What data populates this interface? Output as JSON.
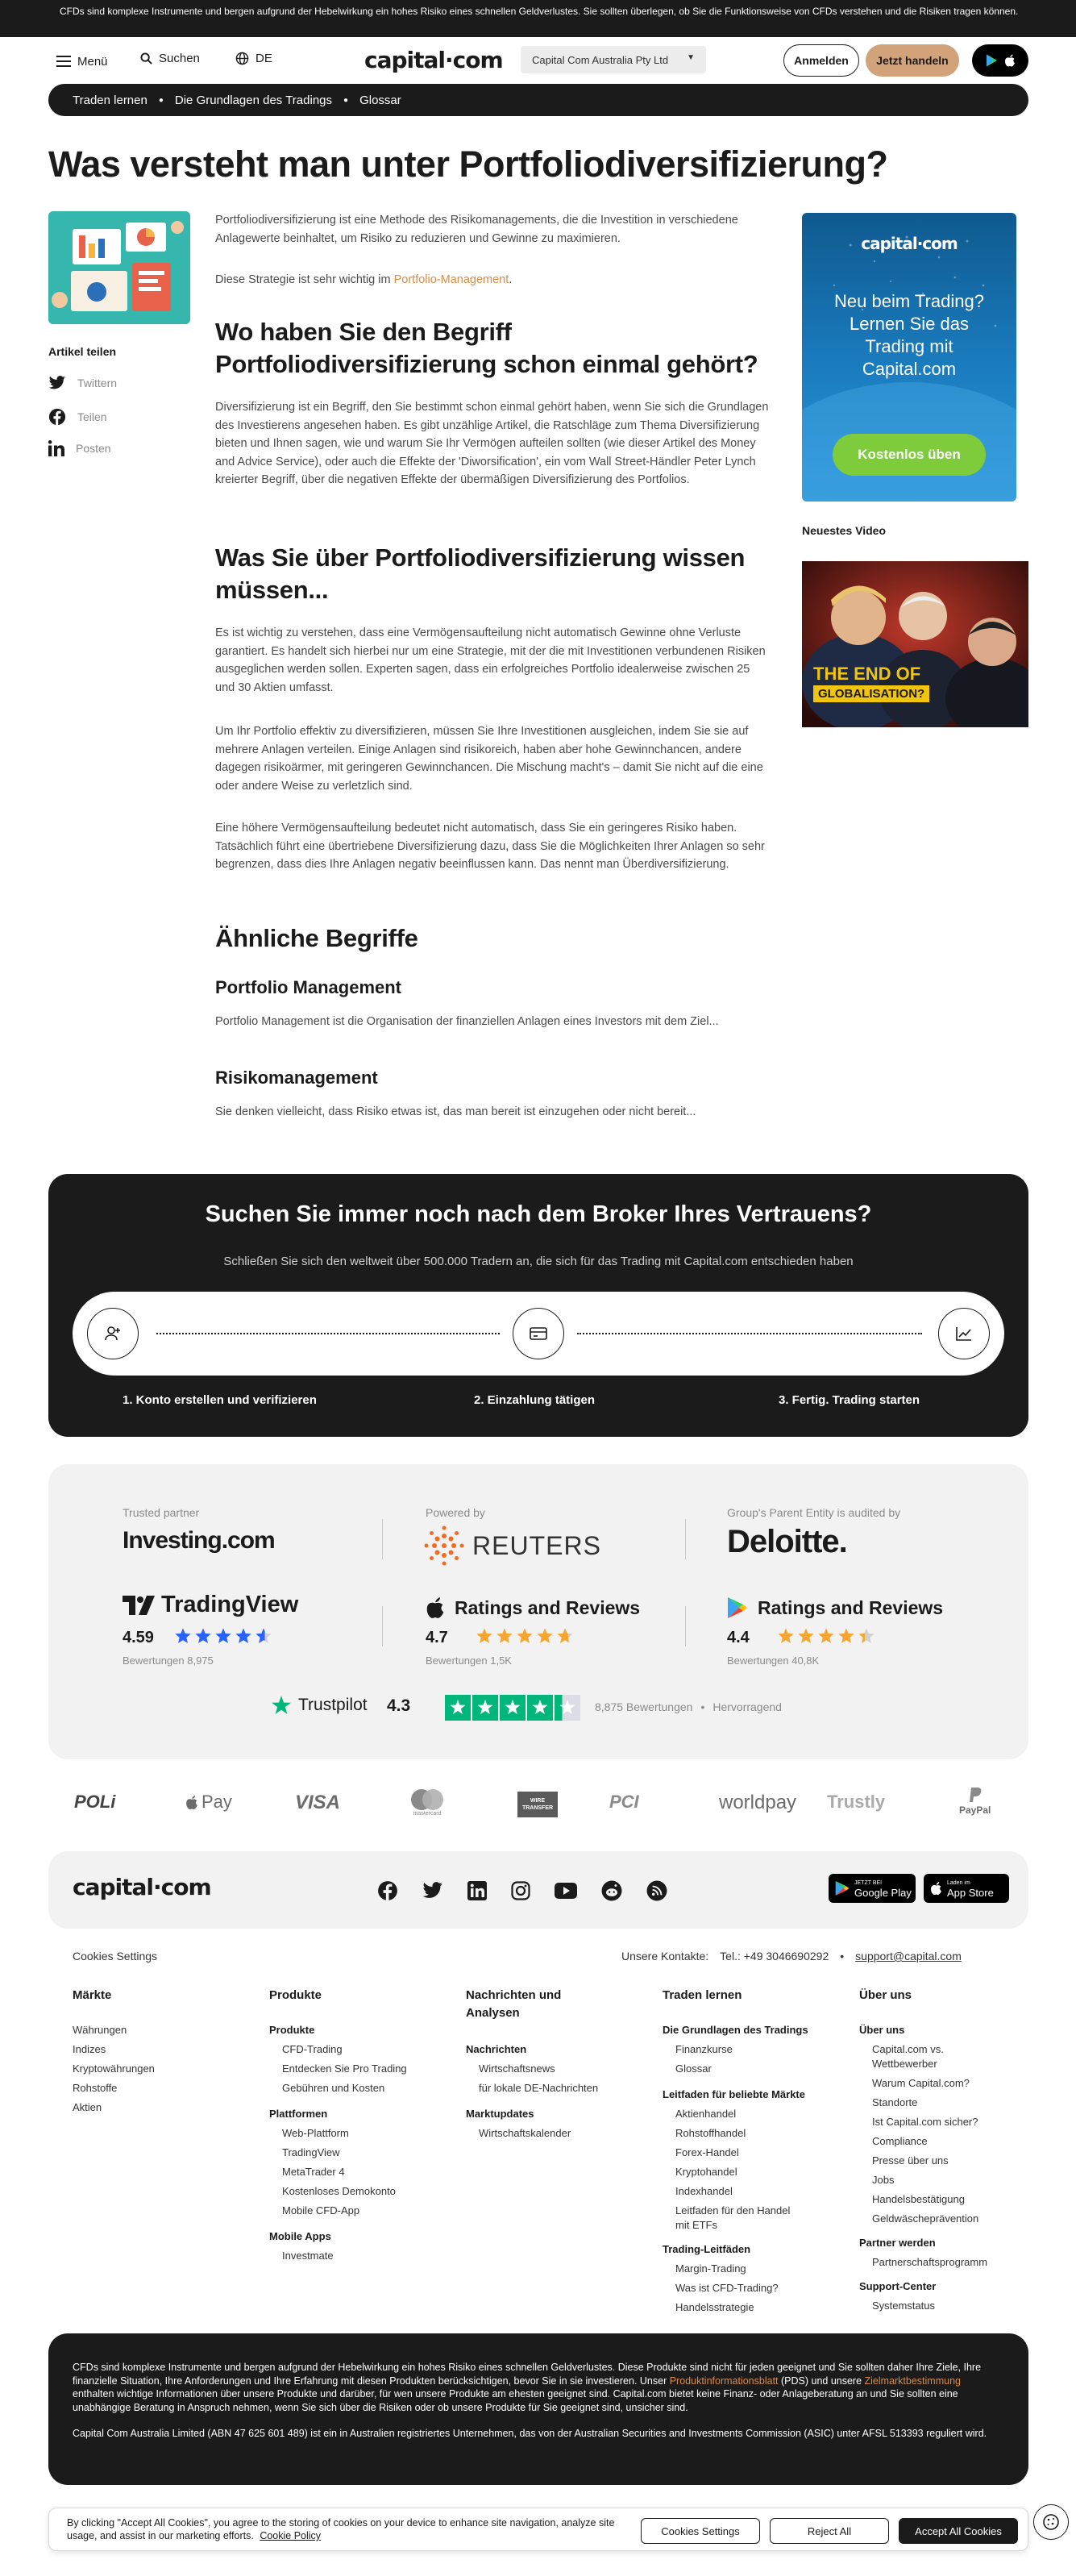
{
  "risk_banner": "CFDs sind komplexe Instrumente und bergen aufgrund der Hebelwirkung ein hohes Risiko eines schnellen Geldverlustes. Sie sollten überlegen, ob Sie die Funktionsweise von CFDs verstehen und die Risiken tragen können.",
  "header": {
    "menu_label": "Menü",
    "search_label": "Suchen",
    "language": "DE",
    "logo": "capital·com",
    "entity_select": "Capital Com Australia Pty Ltd",
    "login": "Anmelden",
    "trade": "Jetzt handeln"
  },
  "breadcrumb": [
    "Traden lernen",
    "Die Grundlagen des Tradings",
    "Glossar"
  ],
  "title": "Was versteht man unter Portfoliodiversifizierung?",
  "share": {
    "title": "Artikel teilen",
    "items": [
      "Twittern",
      "Teilen",
      "Posten"
    ]
  },
  "article": {
    "intro": "Portfoliodiversifizierung ist eine Methode des Risikomanagements, die die Investition in verschiedene Anlagewerte beinhaltet, um Risiko zu reduzieren und Gewinne zu maximieren.",
    "strategy_prefix": "Diese Strategie ist sehr wichtig im ",
    "strategy_link": "Portfolio-Management",
    "strategy_suffix": ".",
    "h2_1": "Wo haben Sie den Begriff Portfoliodiversifizierung schon einmal gehört?",
    "p1": "Diversifizierung ist ein Begriff, den Sie bestimmt schon einmal gehört haben, wenn Sie sich die Grundlagen des Investierens angesehen haben. Es gibt unzählige Artikel, die Ratschläge zum Thema Diversifizierung bieten und Ihnen sagen, wie und warum Sie Ihr Vermögen aufteilen sollten (wie dieser Artikel des Money and Advice Service), oder auch die Effekte der 'Diworsification', ein vom Wall Street-Händler Peter Lynch kreierter Begriff, über die negativen Effekte der übermäßigen Diversifizierung des Portfolios.",
    "h2_2": "Was Sie über Portfoliodiversifizierung wissen müssen...",
    "p2": "Es ist wichtig zu verstehen, dass eine Vermögensaufteilung nicht automatisch Gewinne ohne Verluste garantiert. Es handelt sich hierbei nur um eine Strategie, mit der die mit Investitionen verbundenen Risiken ausgeglichen werden sollen. Experten sagen, dass ein erfolgreiches Portfolio idealerweise zwischen 25 und 30 Aktien umfasst.",
    "p3": "Um Ihr Portfolio effektiv zu diversifizieren, müssen Sie Ihre Investitionen ausgleichen, indem Sie sie auf mehrere Anlagen verteilen. Einige Anlagen sind risikoreich, haben aber hohe Gewinnchancen, andere dagegen risikoärmer, mit geringeren Gewinnchancen. Die Mischung macht's – damit Sie nicht auf die eine oder andere Weise zu verletzlich sind.",
    "p4": "Eine höhere Vermögensaufteilung bedeutet nicht automatisch, dass Sie ein geringeres Risiko haben. Tatsächlich führt eine übertriebene Diversifizierung dazu, dass Sie die Möglichkeiten Ihrer Anlagen so sehr begrenzen, dass dies Ihre Anlagen negativ beeinflussen kann. Das nennt man Überdiversifizierung.",
    "related_title": "Ähnliche Begriffe",
    "related": [
      {
        "title": "Portfolio Management",
        "text": "Portfolio Management ist die Organisation der finanziellen Anlagen eines Investors mit dem Ziel..."
      },
      {
        "title": "Risikomanagement",
        "text": "Sie denken vielleicht, dass Risiko etwas ist, das man bereit ist einzugehen oder nicht bereit..."
      }
    ]
  },
  "promo": {
    "logo": "capital·com",
    "text": "Neu beim Trading? Lernen Sie das Trading mit Capital.com",
    "button": "Kostenlos üben"
  },
  "video": {
    "label": "Neuestes Video",
    "caption_line1": "THE END OF",
    "caption_line2": "GLOBALISATION?"
  },
  "cta": {
    "title": "Suchen Sie immer noch nach dem Broker Ihres Vertrauens?",
    "subtitle": "Schließen Sie sich den weltweit über 500.000 Tradern an, die sich für das Trading mit Capital.com entschieden haben",
    "steps": [
      "1. Konto erstellen und verifizieren",
      "2. Einzahlung tätigen",
      "3. Fertig. Trading starten"
    ]
  },
  "trust": {
    "partners": [
      {
        "label": "Trusted partner",
        "name": "Investing.com"
      },
      {
        "label": "Powered by",
        "name": "REUTERS"
      },
      {
        "label": "Group's Parent Entity is audited by",
        "name": "Deloitte."
      }
    ],
    "ratings": [
      {
        "name": "TradingView",
        "score": "4.59",
        "reviews": "Bewertungen 8,975",
        "stars": 4.59,
        "color": "#2962ff"
      },
      {
        "name": "Ratings and Reviews",
        "score": "4.7",
        "reviews": "Bewertungen 1,5K",
        "stars": 4.7,
        "color": "#f4a532"
      },
      {
        "name": "Ratings and Reviews",
        "score": "4.4",
        "reviews": "Bewertungen 40,8K",
        "stars": 4.4,
        "color": "#f4a532"
      }
    ],
    "trustpilot": {
      "name": "Trustpilot",
      "score": "4.3",
      "reviews": "8,875 Bewertungen",
      "verdict": "Hervorragend",
      "stars": 4.3
    }
  },
  "payments": [
    "POLi",
    "Pay",
    "VISA",
    "mastercard",
    "WIRE TRANSFER",
    "PCI",
    "worldpay",
    "Trustly",
    "PayPal"
  ],
  "footer": {
    "logo": "capital·com",
    "google_play_small": "JETZT BEI",
    "google_play": "Google Play",
    "app_store_small": "Laden im",
    "app_store": "App Store",
    "cookies_settings": "Cookies Settings",
    "contacts_label": "Unsere Kontakte:",
    "phone": "Tel.: +49 3046690292",
    "email": "support@capital.com",
    "col1_title": "Märkte",
    "col1": [
      "Währungen",
      "Indizes",
      "Kryptowährungen",
      "Rohstoffe",
      "Aktien"
    ],
    "col2_title": "Produkte",
    "col2_sub1": "Produkte",
    "col2_links1": [
      "CFD-Trading",
      "Entdecken Sie Pro Trading",
      "Gebühren und Kosten"
    ],
    "col2_sub2": "Plattformen",
    "col2_links2": [
      "Web-Plattform",
      "TradingView",
      "MetaTrader 4",
      "Kostenloses Demokonto",
      "Mobile CFD-App"
    ],
    "col2_sub3": "Mobile Apps",
    "col2_links3": [
      "Investmate"
    ],
    "col3_title_1": "Nachrichten und",
    "col3_title_2": "Analysen",
    "col3_sub1": "Nachrichten",
    "col3_links1": [
      "Wirtschaftsnews",
      "für lokale DE-Nachrichten"
    ],
    "col3_sub2": "Marktupdates",
    "col3_links2": [
      "Wirtschaftskalender"
    ],
    "col4_title": "Traden lernen",
    "col4_sub1": "Die Grundlagen des Tradings",
    "col4_links1": [
      "Finanzkurse",
      "Glossar"
    ],
    "col4_sub2": "Leitfaden für beliebte Märkte",
    "col4_links2": [
      "Aktienhandel",
      "Rohstoffhandel",
      "Forex-Handel",
      "Kryptohandel",
      "Indexhandel",
      "Leitfaden für den Handel",
      "mit ETFs"
    ],
    "col4_sub3": "Trading-Leitfäden",
    "col4_links3": [
      "Margin-Trading",
      "Was ist CFD-Trading?",
      "Handelsstrategie"
    ],
    "col5_title": "Über uns",
    "col5_sub1": "Über uns",
    "col5_links1": [
      "Capital.com vs.",
      "Wettbewerber",
      "Warum Capital.com?",
      "Standorte",
      "Ist Capital.com sicher?",
      "Compliance",
      "Presse über uns",
      "Jobs",
      "Handelsbestätigung",
      "Geldwäscheprävention"
    ],
    "col5_sub2": "Partner werden",
    "col5_links2": [
      "Partnerschaftsprogramm"
    ],
    "col5_sub3": "Support-Center",
    "col5_links3": [
      "Systemstatus"
    ]
  },
  "disclaimer": {
    "p1_a": "CFDs sind komplexe Instrumente und bergen aufgrund der Hebelwirkung ein hohes Risiko eines schnellen Geldverlustes. Diese Produkte sind nicht für jeden geeignet und Sie sollten daher Ihre Ziele, Ihre finanzielle Situation, Ihre Anforderungen und Ihre Erfahrung mit diesen Produkten berücksichtigen, bevor Sie in sie investieren. Unser ",
    "p1_link1": "Produktinformationsblatt",
    "p1_b": " (PDS) und unsere ",
    "p1_link2": "Zielmarktbestimmung",
    "p1_c": " enthalten wichtige Informationen über unsere Produkte und darüber, für wen unsere Produkte am ehesten geeignet sind. Capital.com bietet keine Finanz- oder Anlageberatung an und Sie sollten eine unabhängige Beratung in Anspruch nehmen, wenn Sie sich über die Risiken oder ob unsere Produkte für Sie geeignet sind, unsicher sind.",
    "p2": "Capital Com Australia Limited (ABN 47 625 601 489) ist ein in Australien registriertes Unternehmen, das von der Australian Securities and Investments Commission (ASIC) unter AFSL 513393 reguliert wird."
  },
  "cookie": {
    "text": "By clicking \"Accept All Cookies\", you agree to the storing of cookies on your device to enhance site navigation, analyze site usage, and assist in our marketing efforts.",
    "policy": "Cookie Policy",
    "settings": "Cookies Settings",
    "reject": "Reject All",
    "accept": "Accept All Cookies"
  }
}
